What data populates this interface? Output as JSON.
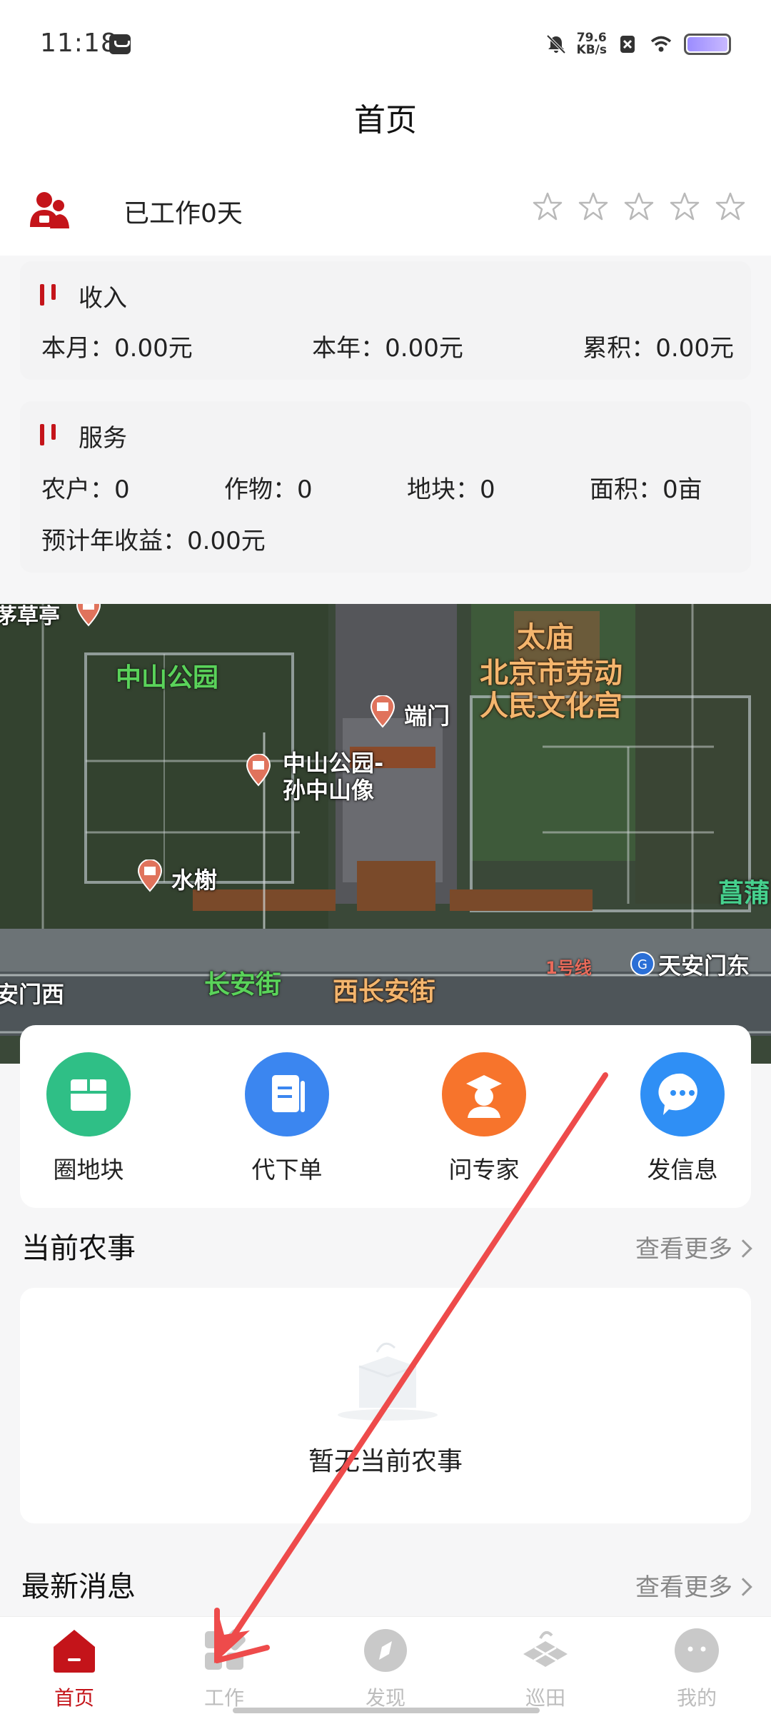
{
  "status_bar": {
    "time": "11:18",
    "net_speed_value": "79.6",
    "net_speed_unit": "KB/s"
  },
  "header": {
    "title": "首页"
  },
  "profile": {
    "work_days": "已工作0天",
    "rating": 0,
    "rating_max": 5
  },
  "income": {
    "title": "收入",
    "month": "本月：0.00元",
    "year": "本年：0.00元",
    "total": "累积：0.00元"
  },
  "service": {
    "title": "服务",
    "farmers": "农户：0",
    "crops": "作物：0",
    "plots": "地块：0",
    "area": "面积：0亩",
    "expected_income": "预计年收益：0.00元"
  },
  "map": {
    "labels": {
      "zhongshan_park": "中山公园",
      "duanmen": "端门",
      "statue_line1": "中山公园-",
      "statue_line2": "孙中山像",
      "shuixie": "水榭",
      "changan_street": "长安街",
      "west_changan": "西长安街",
      "taimiao": "太庙",
      "culture_palace_line1": "北京市劳动",
      "culture_palace_line2": "人民文化宫",
      "line1": "1号线",
      "tiananmen_east": "天安门东",
      "tiananmen_west": "安门西",
      "changpu": "菖蒲",
      "top_left": "茅草亭"
    }
  },
  "quick_actions": [
    {
      "label": "圈地块",
      "icon": "box-icon",
      "color": "#2fbf86"
    },
    {
      "label": "代下单",
      "icon": "document-icon",
      "color": "#3b86f0"
    },
    {
      "label": "问专家",
      "icon": "expert-icon",
      "color": "#f7742c"
    },
    {
      "label": "发信息",
      "icon": "chat-icon",
      "color": "#2f8ff5"
    }
  ],
  "current_farming": {
    "title": "当前农事",
    "more": "查看更多",
    "empty_text": "暂无当前农事"
  },
  "latest_news": {
    "title": "最新消息",
    "more": "查看更多"
  },
  "bottom_nav": [
    {
      "label": "首页",
      "active": true
    },
    {
      "label": "工作",
      "active": false
    },
    {
      "label": "发现",
      "active": false
    },
    {
      "label": "巡田",
      "active": false
    },
    {
      "label": "我的",
      "active": false
    }
  ],
  "colors": {
    "brand_red": "#c4141a",
    "annotation_arrow": "#ee4b4b"
  }
}
